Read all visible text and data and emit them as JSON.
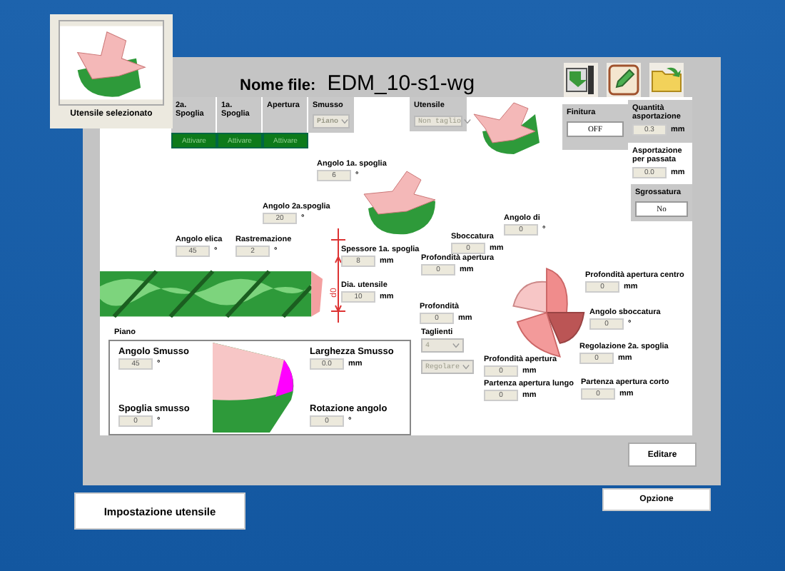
{
  "thumbnail": {
    "caption": "Utensile selezionato"
  },
  "header": {
    "label": "Nome file:",
    "value": "EDM_10-s1-wg"
  },
  "tabs": [
    {
      "label": "2a. Spoglia",
      "button": "Attivare"
    },
    {
      "label": "1a. Spoglia",
      "button": "Attivare"
    },
    {
      "label": "Apertura",
      "button": "Attivare"
    }
  ],
  "smusso": {
    "label": "Smusso",
    "value": "Piano"
  },
  "utensile": {
    "label": "Utensile",
    "value": "Non taglio"
  },
  "finitura": {
    "label": "Finitura",
    "value": "OFF"
  },
  "asportazione": [
    {
      "label": "Quantità asportazione",
      "value": "0.3",
      "unit": "mm"
    },
    {
      "label": "Asportazione per passata",
      "value": "0.0",
      "unit": "mm"
    }
  ],
  "sgrossatura": {
    "label": "Sgrossatura",
    "value": "No"
  },
  "fields": [
    {
      "kind": "input",
      "label": "Angolo 1a. spoglia",
      "value": "6",
      "unit": "°"
    },
    {
      "kind": "input",
      "label": "Angolo 2a.spoglia",
      "value": "20",
      "unit": "°"
    },
    {
      "kind": "input",
      "label": "Angolo elica",
      "value": "45",
      "unit": "°"
    },
    {
      "kind": "input",
      "label": "Rastremazione",
      "value": "2",
      "unit": "°"
    },
    {
      "kind": "input",
      "label": "Spessore 1a. spoglia",
      "value": "8",
      "unit": "mm"
    },
    {
      "kind": "input",
      "label": "Dia. utensile",
      "value": "10",
      "unit": "mm"
    },
    {
      "kind": "input",
      "label": "Angolo di",
      "value": "0",
      "unit": "°"
    },
    {
      "kind": "input",
      "label": "Sboccatura",
      "value": "0",
      "unit": "mm"
    },
    {
      "kind": "input",
      "label": "Profondità apertura",
      "value": "0",
      "unit": "mm"
    },
    {
      "kind": "input",
      "label": "Profondità",
      "value": "0",
      "unit": "mm"
    },
    {
      "kind": "select",
      "label": "Taglienti",
      "value": "4"
    },
    {
      "kind": "select",
      "value": "Regolare"
    },
    {
      "kind": "input",
      "label": "Profondità apertura",
      "value": "0",
      "unit": "mm"
    },
    {
      "kind": "input",
      "label": "Partenza apertura lungo",
      "value": "0",
      "unit": "mm"
    },
    {
      "kind": "input",
      "label": "Profondità apertura centro",
      "value": "0",
      "unit": "mm"
    },
    {
      "kind": "input",
      "label": "Angolo sboccatura",
      "value": "0",
      "unit": "°"
    },
    {
      "kind": "input",
      "label": "Regolazione 2a. spoglia",
      "value": "0",
      "unit": "mm"
    },
    {
      "kind": "input",
      "label": "Partenza apertura corto",
      "value": "0",
      "unit": "mm"
    }
  ],
  "dimension_label": "d0",
  "piano": {
    "title": "Piano",
    "fields": [
      {
        "label": "Angolo Smusso",
        "value": "45",
        "unit": "°"
      },
      {
        "label": "Spoglia smusso",
        "value": "0",
        "unit": "°"
      },
      {
        "label": "Larghezza Smusso",
        "value": "0.0",
        "unit": "mm"
      },
      {
        "label": "Rotazione angolo",
        "value": "0",
        "unit": "°"
      }
    ]
  },
  "edit_button": "Editare",
  "option_button": "Opzione",
  "setup_button": "Impostazione utensile"
}
